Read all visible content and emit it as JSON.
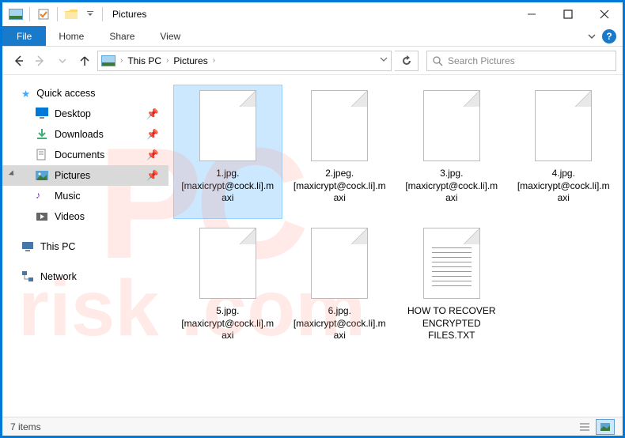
{
  "window": {
    "title": "Pictures"
  },
  "ribbon": {
    "file": "File",
    "home": "Home",
    "share": "Share",
    "view": "View"
  },
  "breadcrumb": {
    "root": "This PC",
    "current": "Pictures"
  },
  "search": {
    "placeholder": "Search Pictures"
  },
  "sidebar": {
    "quick_access": "Quick access",
    "items": [
      {
        "label": "Desktop",
        "icon": "desktop"
      },
      {
        "label": "Downloads",
        "icon": "downloads"
      },
      {
        "label": "Documents",
        "icon": "documents"
      },
      {
        "label": "Pictures",
        "icon": "pictures",
        "selected": true
      },
      {
        "label": "Music",
        "icon": "music"
      },
      {
        "label": "Videos",
        "icon": "videos"
      }
    ],
    "this_pc": "This PC",
    "network": "Network"
  },
  "files": [
    {
      "name": "1.jpg.[maxicrypt@cock.li].maxi",
      "type": "file",
      "selected": true
    },
    {
      "name": "2.jpeg.[maxicrypt@cock.li].maxi",
      "type": "file"
    },
    {
      "name": "3.jpg.[maxicrypt@cock.li].maxi",
      "type": "file"
    },
    {
      "name": "4.jpg.[maxicrypt@cock.li].maxi",
      "type": "file"
    },
    {
      "name": "5.jpg.[maxicrypt@cock.li].maxi",
      "type": "file"
    },
    {
      "name": "6.jpg.[maxicrypt@cock.li].maxi",
      "type": "file"
    },
    {
      "name": "HOW TO RECOVER ENCRYPTED FILES.TXT",
      "type": "text"
    }
  ],
  "status": {
    "count": "7 items"
  }
}
